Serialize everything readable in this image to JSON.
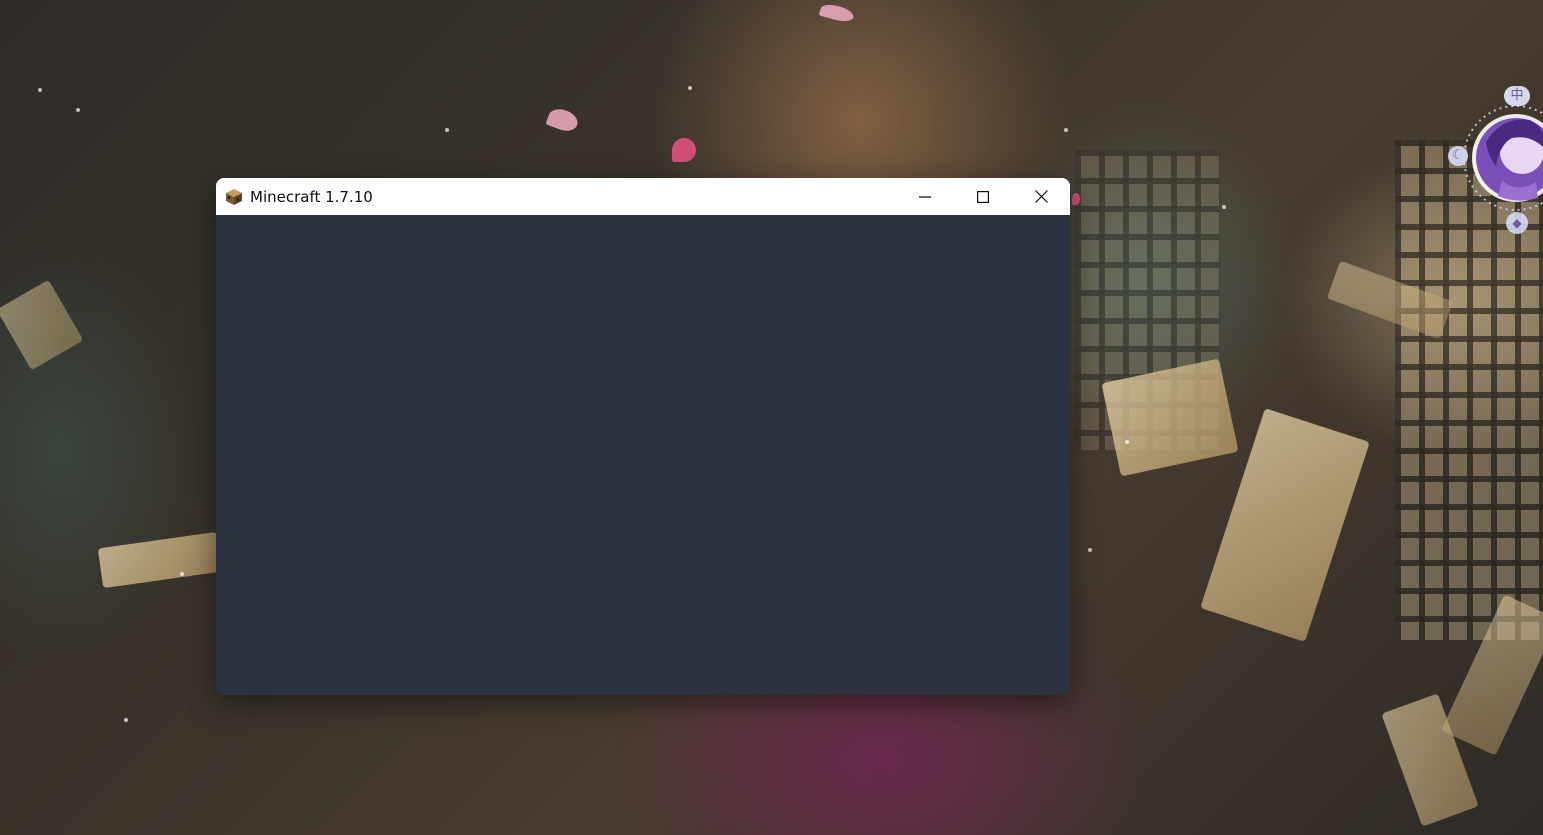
{
  "window": {
    "title": "Minecraft 1.7.10",
    "app_icon": "minecraft-block-icon",
    "buttons": {
      "minimize": "minimize-icon",
      "maximize": "maximize-icon",
      "close": "close-icon"
    },
    "client_color": "#2b3240",
    "titlebar_color": "#ffffff"
  },
  "desktop": {
    "widget_badge": "中",
    "widget_icons": [
      "moon-icon",
      "shirt-icon"
    ]
  }
}
